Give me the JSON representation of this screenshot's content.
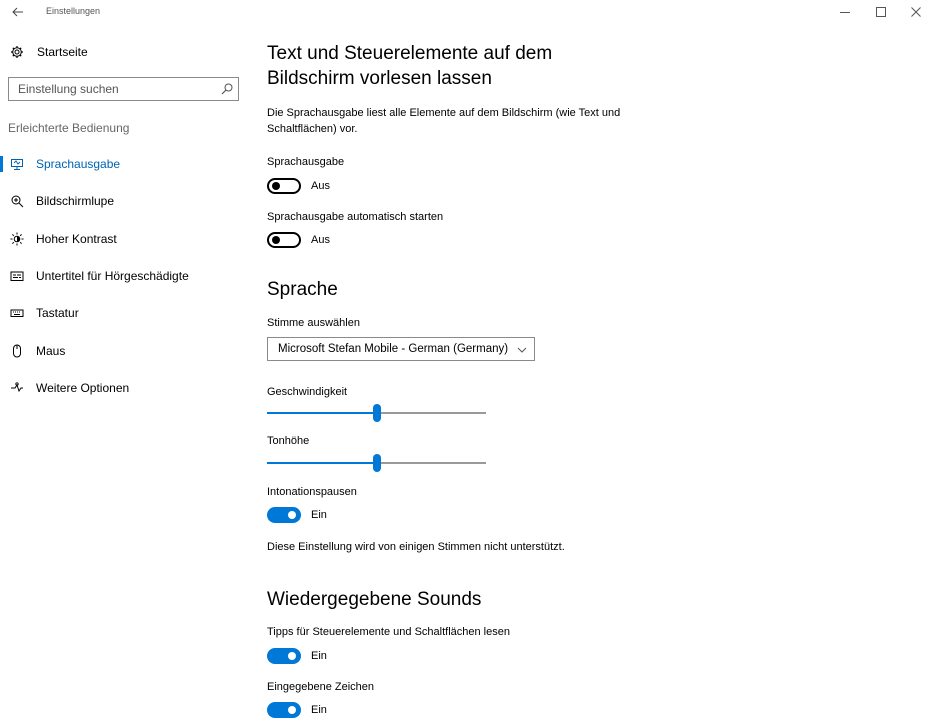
{
  "window": {
    "title": "Einstellungen"
  },
  "sidebar": {
    "home_label": "Startseite",
    "search_placeholder": "Einstellung suchen",
    "category": "Erleichterte Bedienung",
    "items": [
      {
        "label": "Sprachausgabe",
        "icon": "narrator-icon",
        "active": true
      },
      {
        "label": "Bildschirmlupe",
        "icon": "magnifier-icon",
        "active": false
      },
      {
        "label": "Hoher Kontrast",
        "icon": "high-contrast-icon",
        "active": false
      },
      {
        "label": "Untertitel für Hörgeschädigte",
        "icon": "closed-captions-icon",
        "active": false
      },
      {
        "label": "Tastatur",
        "icon": "keyboard-icon",
        "active": false
      },
      {
        "label": "Maus",
        "icon": "mouse-icon",
        "active": false
      },
      {
        "label": "Weitere Optionen",
        "icon": "other-options-icon",
        "active": false
      }
    ]
  },
  "main": {
    "title": "Text und Steuerelemente auf dem Bildschirm vorlesen lassen",
    "description": "Die Sprachausgabe liest alle Elemente auf dem Bildschirm (wie Text und Schaltflächen) vor.",
    "narrator": {
      "label": "Sprachausgabe",
      "state": "Aus",
      "on": false
    },
    "autostart": {
      "label": "Sprachausgabe automatisch starten",
      "state": "Aus",
      "on": false
    },
    "language": {
      "heading": "Sprache",
      "voice_label": "Stimme auswählen",
      "voice_value": "Microsoft Stefan Mobile - German (Germany)",
      "speed_label": "Geschwindigkeit",
      "speed_value": 0.5,
      "pitch_label": "Tonhöhe",
      "pitch_value": 0.5,
      "pauses_label": "Intonationspausen",
      "pauses_state": "Ein",
      "pauses_on": true,
      "note": "Diese Einstellung wird von einigen Stimmen nicht unterstützt."
    },
    "sounds": {
      "heading": "Wiedergegebene Sounds",
      "hints_label": "Tipps für Steuerelemente und Schaltflächen lesen",
      "hints_state": "Ein",
      "typed_label": "Eingegebene Zeichen",
      "typed_state": "Ein"
    }
  },
  "colors": {
    "accent": "#0078d7",
    "active_text": "#0063b1"
  }
}
